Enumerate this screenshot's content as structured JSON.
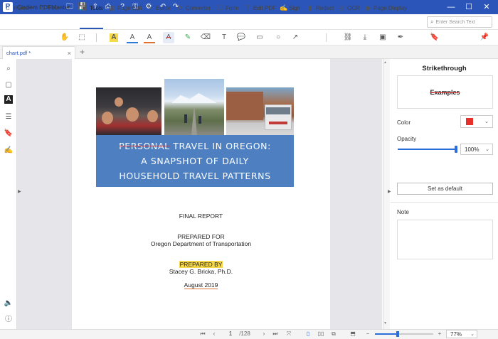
{
  "app": {
    "title": "Cisdem PDFMaster",
    "logo": "P"
  },
  "titlebar": {
    "icons": [
      "folder-icon",
      "save-icon",
      "share-icon",
      "print-icon",
      "help-icon",
      "key-icon",
      "settings-icon",
      "undo-icon",
      "redo-icon"
    ],
    "glyphs": [
      "🗀",
      "💾",
      "⇪",
      "⎙",
      "?",
      "⚿",
      "⚙",
      "↶",
      "↷"
    ],
    "window_controls": {
      "minimize": "—",
      "maximize": "☐",
      "close": "✕"
    }
  },
  "toolbar": {
    "items": [
      {
        "name": "home",
        "label": "Home",
        "glyph": "⌂"
      },
      {
        "name": "file",
        "label": "File",
        "glyph": "▭"
      },
      {
        "name": "tools",
        "label": "Tools",
        "glyph": "▣"
      },
      {
        "name": "page-edit",
        "label": "Page Edit",
        "glyph": "▦"
      },
      {
        "name": "editor",
        "label": "Editor",
        "glyph": "✎"
      },
      {
        "name": "converter",
        "label": "Converter",
        "glyph": "⟳"
      },
      {
        "name": "form",
        "label": "Form",
        "glyph": "☐"
      },
      {
        "name": "edit-pdf",
        "label": "Edit PDF",
        "glyph": "T"
      },
      {
        "name": "sign",
        "label": "Sign",
        "glyph": "✍"
      },
      {
        "name": "redact",
        "label": "Redact",
        "glyph": "▮"
      },
      {
        "name": "ocr",
        "label": "OCR",
        "glyph": "◎"
      },
      {
        "name": "page-display",
        "label": "Page Display",
        "glyph": "◉"
      }
    ],
    "active": "Tools",
    "search": {
      "placeholder": "Enter Search Text",
      "value": ""
    }
  },
  "subtoolbar": {
    "glyphs": [
      "✋",
      "⬚",
      "A",
      "A",
      "A",
      "A",
      "✎",
      "⌫",
      "T",
      "💬",
      "▭",
      "○",
      "↗",
      "⛓",
      "⤓",
      "▣",
      "✒",
      "🔖",
      "📌"
    ]
  },
  "tab": {
    "name": "chart.pdf *",
    "close": "×",
    "add": "+"
  },
  "left_sidebar": {
    "glyphs": [
      "⌕",
      "▢",
      "A",
      "☰",
      "🔖",
      "✍",
      "🔈",
      "ⓘ"
    ]
  },
  "document": {
    "title_line_1_struck": "PERSONAL",
    "title_line_1_rest": " TRAVEL IN OREGON:",
    "title_line_2": "A SNAPSHOT OF DAILY",
    "title_line_3": "HOUSEHOLD TRAVEL PATTERNS",
    "report": "FINAL REPORT",
    "prepared_for": "PREPARED FOR",
    "department": "Oregon Department of Transportation",
    "prepared_by": "PREPARED BY",
    "author": "Stacey G. Bricka, Ph.D.",
    "date": "August 2019"
  },
  "right_panel": {
    "title": "Strikethrough",
    "preview": "Examples",
    "color_label": "Color",
    "color_value": "#e8302a",
    "opacity_label": "Opacity",
    "opacity_value": "100%",
    "opacity_fraction": 1.0,
    "default_button": "Set as default",
    "note_label": "Note"
  },
  "statusbar": {
    "glyphs": [
      "⏮",
      "‹",
      "›",
      "⏭",
      "⤧",
      "▯",
      "▯▯",
      "⧉",
      "⬒",
      "−",
      "+"
    ],
    "current_page": "1",
    "total_pages": "/128",
    "zoom": "77%",
    "zoom_fraction": 0.39
  }
}
